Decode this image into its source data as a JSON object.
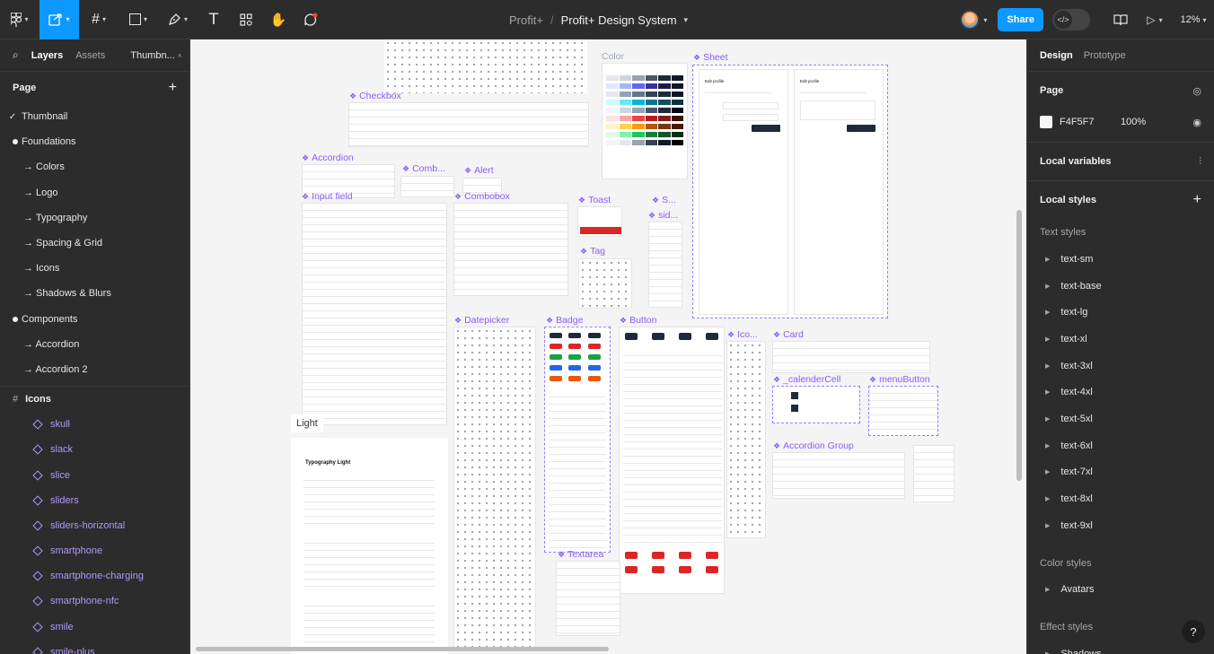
{
  "toolbar": {
    "project": "Profit+",
    "separator": "/",
    "file_name": "Profit+ Design System",
    "share_label": "Share",
    "zoom": "12%"
  },
  "left_panel": {
    "tabs": [
      "Layers",
      "Assets",
      "Thumbn..."
    ],
    "pages_title": "Page",
    "pages": [
      {
        "label": "Thumbnail",
        "kind": "checked"
      },
      {
        "label": "Foundations",
        "kind": "bullet"
      },
      {
        "label": "→ Colors",
        "kind": "sub"
      },
      {
        "label": "→ Logo",
        "kind": "sub"
      },
      {
        "label": "→ Typography",
        "kind": "sub"
      },
      {
        "label": "→ Spacing & Grid",
        "kind": "sub"
      },
      {
        "label": "→ Icons",
        "kind": "sub"
      },
      {
        "label": "→ Shadows & Blurs",
        "kind": "sub"
      },
      {
        "label": "Components",
        "kind": "bullet"
      },
      {
        "label": "→ Accordion",
        "kind": "sub"
      },
      {
        "label": "→ Accordion 2",
        "kind": "sub"
      }
    ],
    "frame_label": "Icons",
    "layers": [
      "skull",
      "slack",
      "slice",
      "sliders",
      "sliders-horizontal",
      "smartphone",
      "smartphone-charging",
      "smartphone-nfc",
      "smile",
      "smile-plus"
    ]
  },
  "canvas": {
    "labels": {
      "checkbox": "Checkbox",
      "color": "Color",
      "sheet": "Sheet",
      "accordion": "Accordion",
      "comb": "Comb...",
      "alert": "Alert",
      "input_field": "Input field",
      "combobox": "Combobox",
      "toast": "Toast",
      "s": "S...",
      "sid": "sid...",
      "tag": "Tag",
      "datepicker": "Datepicker",
      "badge": "Badge",
      "button": "Button",
      "ico": "Ico...",
      "card": "Card",
      "calender_cell": "_calenderCell",
      "menu_button": "menuButton",
      "accordion_group": "Accordion Group",
      "textarea": "Textarea",
      "light": "Light",
      "typography_light": "Typography Light",
      "edit_profile": "Edit profile",
      "save_changes": "Save changes"
    }
  },
  "right_panel": {
    "tabs": [
      "Design",
      "Prototype"
    ],
    "page_title": "Page",
    "page_color": "F4F5F7",
    "page_opacity": "100%",
    "local_variables": "Local variables",
    "local_styles": "Local styles",
    "text_styles_title": "Text styles",
    "text_styles": [
      "text-sm",
      "text-base",
      "text-lg",
      "text-xl",
      "text-3xl",
      "text-4xl",
      "text-5xl",
      "text-6xl",
      "text-7xl",
      "text-8xl",
      "text-9xl"
    ],
    "color_styles_title": "Color styles",
    "color_styles": [
      "Avatars"
    ],
    "effect_styles_title": "Effect styles",
    "effect_styles": [
      "Shadows"
    ]
  },
  "colors": {
    "accent": "#0d99ff",
    "component_purple": "#8b5cf6",
    "panel_bg": "#2c2c2c",
    "canvas_bg": "#f4f4f5"
  }
}
